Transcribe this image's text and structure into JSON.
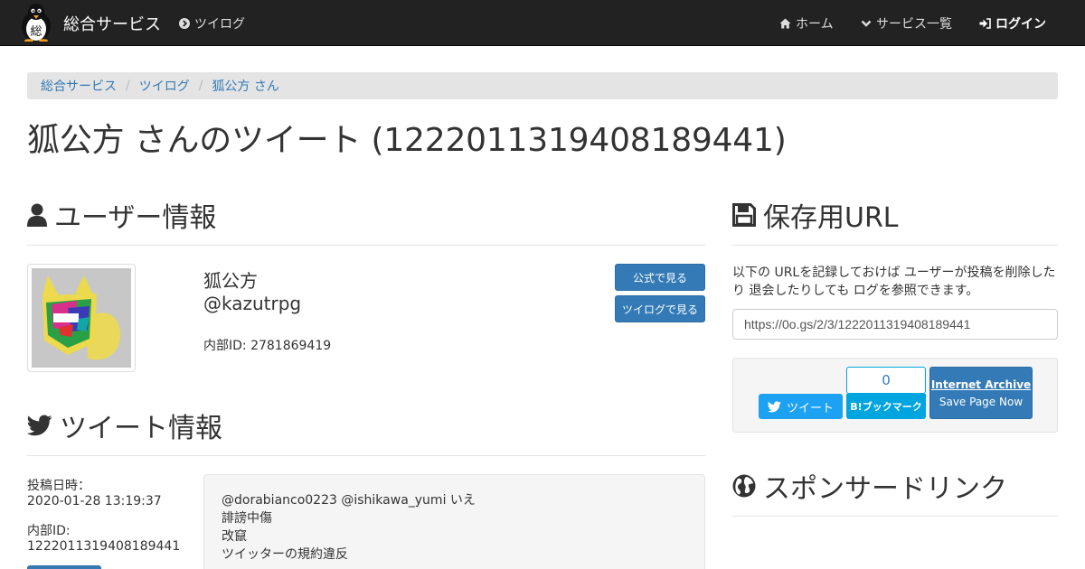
{
  "navbar": {
    "brand": "総合サービス",
    "logo_char": "総",
    "twilog_link": "ツイログ",
    "home_link": "ホーム",
    "services_link": "サービス一覧",
    "login_link": "ログイン"
  },
  "breadcrumb": {
    "items": [
      "総合サービス",
      "ツイログ",
      "狐公方 さん"
    ],
    "separator": "/"
  },
  "page": {
    "title": "狐公方 さんのツイート (1222011319408189441)"
  },
  "user_info": {
    "heading": "ユーザー情報",
    "name": "狐公方",
    "handle": "@kazutrpg",
    "internal_id_line": "内部ID: 2781869419",
    "official_button": "公式で見る",
    "twilog_button": "ツイログで見る"
  },
  "tweet_info": {
    "heading": "ツイート情報",
    "posted_label": "投稿日時：",
    "posted_value": "2020-01-28 13:19:37",
    "id_label": "内部ID:",
    "id_value": "1222011319408189441",
    "text_lines": [
      "@dorabianco0223 @ishikawa_yumi いえ",
      "誹謗中傷",
      "改竄",
      "ツイッターの規約違反"
    ]
  },
  "save_url": {
    "heading": "保存用URL",
    "description": "以下の URLを記録しておけば ユーザーが投稿を削除したり 退会したりしても ログを参照できます。",
    "url": "https://0o.gs/2/3/1222011319408189441",
    "tweet_button": "ツイート",
    "hatena_count": "0",
    "hatena_button": "B!ブックマーク",
    "archive_title": "Internet Archive",
    "archive_sub": "Save Page Now"
  },
  "sponsor": {
    "heading": "スポンサードリンク"
  },
  "colors": {
    "navbar_bg": "#222222",
    "link": "#337ab7",
    "primary": "#337ab7",
    "twitter": "#1da1f2",
    "hatena": "#00a4de"
  },
  "icons": {
    "twilog": "chevron-circle-right-icon",
    "home": "home-icon",
    "services": "chevron-down-icon",
    "login": "sign-in-icon",
    "user_section": "user-icon",
    "tweet_section": "twitter-bird-icon",
    "save_section": "floppy-disk-icon",
    "sponsor_section": "globe-icon"
  }
}
